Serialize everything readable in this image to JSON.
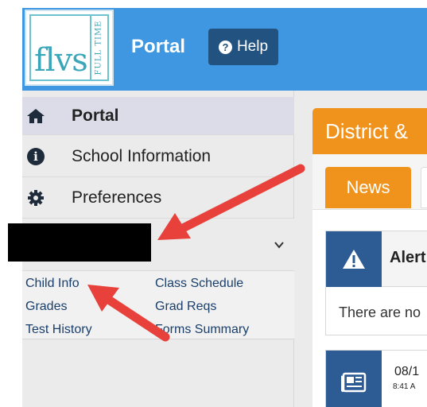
{
  "header": {
    "logo_text": "flvs",
    "logo_side_text": "FULL TIME",
    "portal_title": "Portal",
    "help_label": "Help",
    "help_icon_glyph": "?"
  },
  "sidebar": {
    "items": [
      {
        "label": "Portal",
        "icon": "home-icon"
      },
      {
        "label": "School Information",
        "icon": "info-icon"
      },
      {
        "label": "Preferences",
        "icon": "gear-icon"
      }
    ],
    "info_glyph": "i",
    "student_links": [
      {
        "label": "Child Info"
      },
      {
        "label": "Class Schedule"
      },
      {
        "label": "Grades"
      },
      {
        "label": "Grad Reqs"
      },
      {
        "label": "Test History"
      },
      {
        "label": "Forms Summary"
      }
    ]
  },
  "main": {
    "district_title": "District &",
    "tabs": [
      {
        "label": "News"
      }
    ],
    "alert_title": "Alert",
    "alert_body": "There are no",
    "news_date": "08/1",
    "news_time": "8:41 A"
  },
  "colors": {
    "header_blue": "#3e97e0",
    "help_button": "#22527f",
    "orange_accent": "#f0931c",
    "card_icon_blue": "#2d5b93",
    "arrow_red": "#e8413b"
  }
}
